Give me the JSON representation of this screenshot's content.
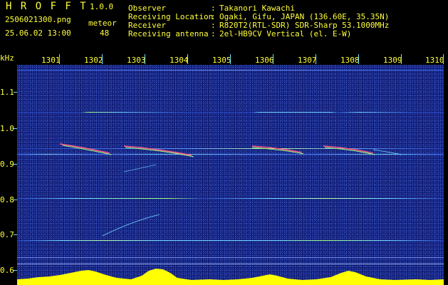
{
  "header": {
    "app_name": "H R O F F T",
    "version": "1.0.0",
    "filename": "2506021300.png",
    "meteor_label": "meteor",
    "datetime": "25.06.02 13:00",
    "meteor_count": "48",
    "rows": [
      {
        "label": "Observer",
        "sep": ":",
        "value": "Takanori Kawachi"
      },
      {
        "label": "Receiving Location",
        "sep": ":",
        "value": "Ogaki, Gifu, JAPAN (136.60E, 35.35N)"
      },
      {
        "label": "Receiver",
        "sep": ":",
        "value": "R820T2(RTL-SDR) SDR-Sharp 53.1000MHz"
      },
      {
        "label": "Receiving antenna",
        "sep": ":",
        "value": "2el-HB9CV Vertical (el. E-W)"
      }
    ]
  },
  "spectrogram": {
    "y_unit": "kHz",
    "y_ticks": [
      "1.1",
      "1.0",
      "0.9",
      "0.8",
      "0.7",
      "0.6"
    ],
    "x_ticks": [
      "1301",
      "1302",
      "1303",
      "1304",
      "1305",
      "1306",
      "1307",
      "1308",
      "1309",
      "1310"
    ],
    "colors": {
      "label": "#ffff3c",
      "accent": "#66e0ff",
      "background": "#101a6e",
      "signal": "#ffff00"
    }
  }
}
